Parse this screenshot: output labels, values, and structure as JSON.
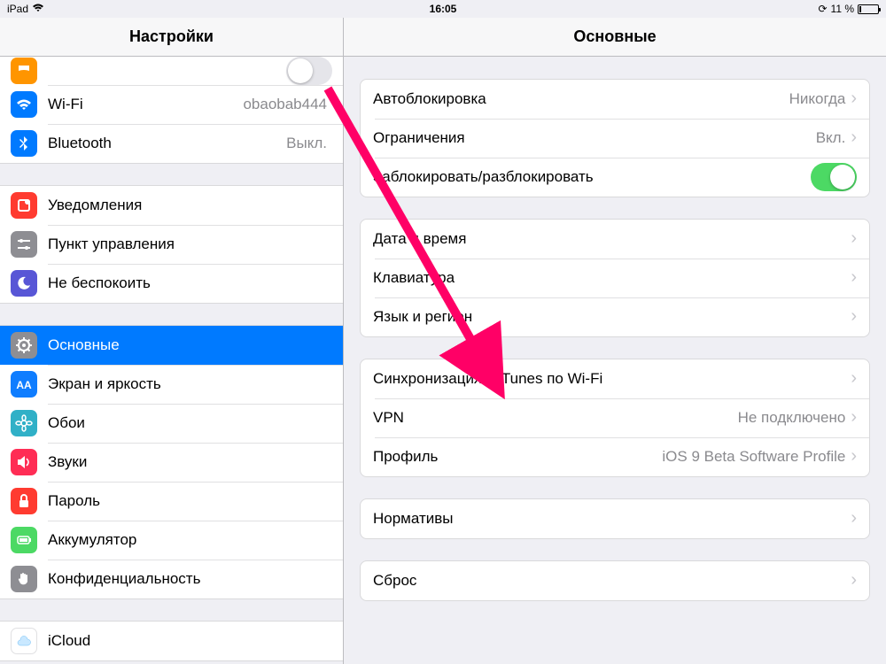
{
  "statusbar": {
    "device": "iPad",
    "time": "16:05",
    "battery_pct": "11 %",
    "lock_icon": "⟳"
  },
  "sidebar": {
    "title": "Настройки",
    "groups": [
      [
        {
          "icon": "toggle",
          "label": "",
          "value": "",
          "switch": "off",
          "color": "orange"
        },
        {
          "icon": "wifi",
          "label": "Wi-Fi",
          "value": "obaobab444",
          "color": "blue"
        },
        {
          "icon": "bluetooth",
          "label": "Bluetooth",
          "value": "Выкл.",
          "color": "blue"
        }
      ],
      [
        {
          "icon": "bell",
          "label": "Уведомления",
          "value": "",
          "color": "red"
        },
        {
          "icon": "controls",
          "label": "Пункт управления",
          "value": "",
          "color": "grey"
        },
        {
          "icon": "moon",
          "label": "Не беспокоить",
          "value": "",
          "color": "purple"
        }
      ],
      [
        {
          "icon": "gear",
          "label": "Основные",
          "value": "",
          "color": "grey",
          "selected": true
        },
        {
          "icon": "aa",
          "label": "Экран и яркость",
          "value": "",
          "color": "bluea"
        },
        {
          "icon": "flower",
          "label": "Обои",
          "value": "",
          "color": "teal"
        },
        {
          "icon": "speaker",
          "label": "Звуки",
          "value": "",
          "color": "pink"
        },
        {
          "icon": "lock",
          "label": "Пароль",
          "value": "",
          "color": "red"
        },
        {
          "icon": "battery",
          "label": "Аккумулятор",
          "value": "",
          "color": "green"
        },
        {
          "icon": "hand",
          "label": "Конфиденциальность",
          "value": "",
          "color": "greyd"
        }
      ],
      [
        {
          "icon": "cloud",
          "label": "iCloud",
          "value": "",
          "color": "white"
        }
      ]
    ]
  },
  "detail": {
    "title": "Основные",
    "groups": [
      [
        {
          "label": "Автоблокировка",
          "value": "Никогда",
          "chev": true
        },
        {
          "label": "Ограничения",
          "value": "Вкл.",
          "chev": true
        },
        {
          "label": "Заблокировать/разблокировать",
          "switch": "on"
        }
      ],
      [
        {
          "label": "Дата и время",
          "chev": true
        },
        {
          "label": "Клавиатура",
          "chev": true
        },
        {
          "label": "Язык и регион",
          "chev": true
        }
      ],
      [
        {
          "label": "Синхронизация с iTunes по Wi-Fi",
          "chev": true
        },
        {
          "label": "VPN",
          "value": "Не подключено",
          "chev": true
        },
        {
          "label": "Профиль",
          "value": "iOS 9 Beta Software Profile",
          "chev": true
        }
      ],
      [
        {
          "label": "Нормативы",
          "chev": true
        }
      ],
      [
        {
          "label": "Сброс",
          "chev": true
        }
      ]
    ]
  }
}
